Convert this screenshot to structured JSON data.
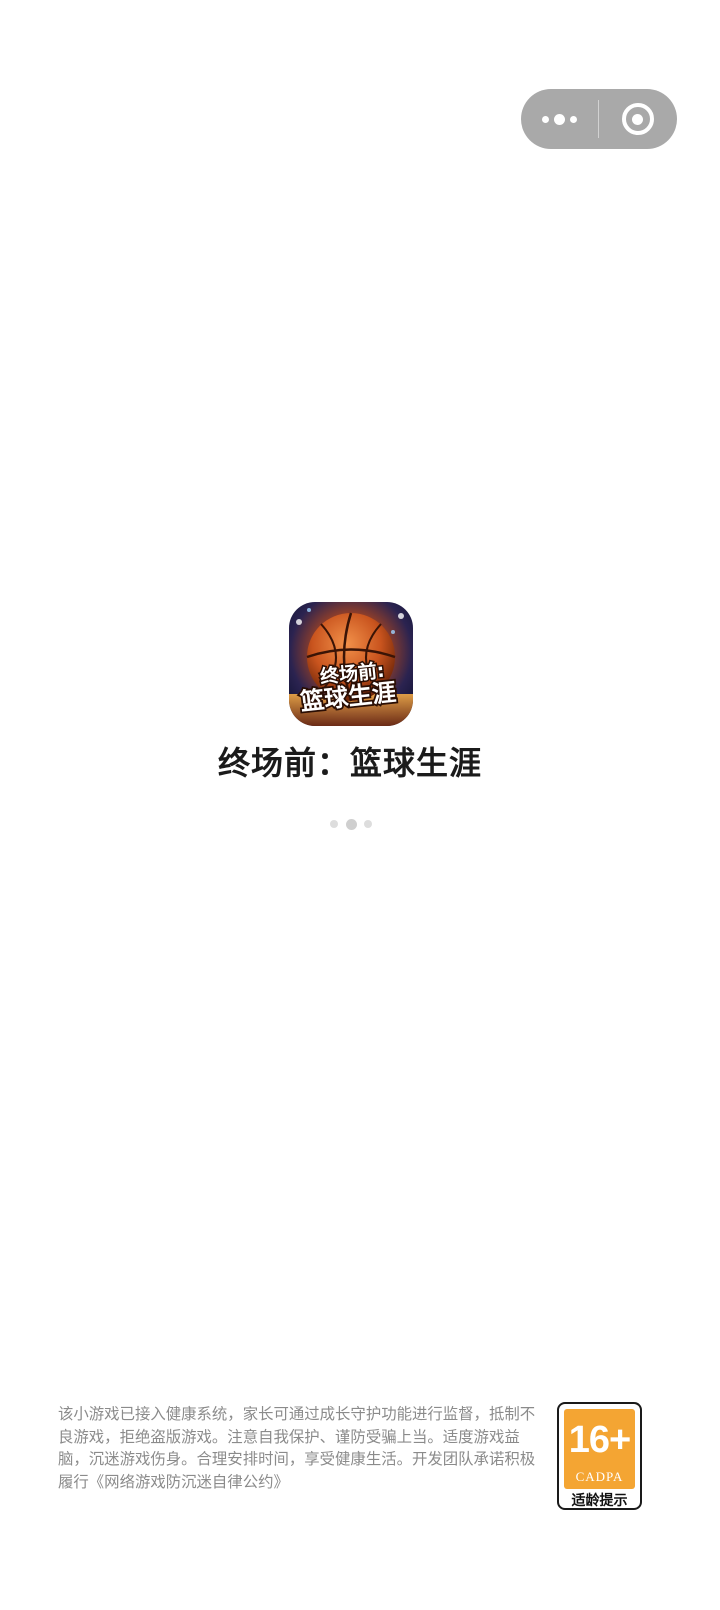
{
  "capsule": {
    "more_icon": "more-dots-icon",
    "close_icon": "target-circle-icon"
  },
  "app": {
    "icon_name": "basketball-app-icon",
    "icon_text_line1": "终场前:",
    "icon_text_line2": "篮球生涯",
    "title": "终场前：篮球生涯"
  },
  "loading": {
    "icon_name": "loading-dots-icon"
  },
  "notice": {
    "text": "该小游戏已接入健康系统，家长可通过成长守护功能进行监督，抵制不良游戏，拒绝盗版游戏。注意自我保护、谨防受骗上当。适度游戏益脑，沉迷游戏伤身。合理安排时间，享受健康生活。开发团队承诺积极履行《网络游戏防沉迷自律公约》"
  },
  "age_rating": {
    "number": "16+",
    "org": "CADPA",
    "caption": "适龄提示",
    "color": "#f4a533"
  }
}
